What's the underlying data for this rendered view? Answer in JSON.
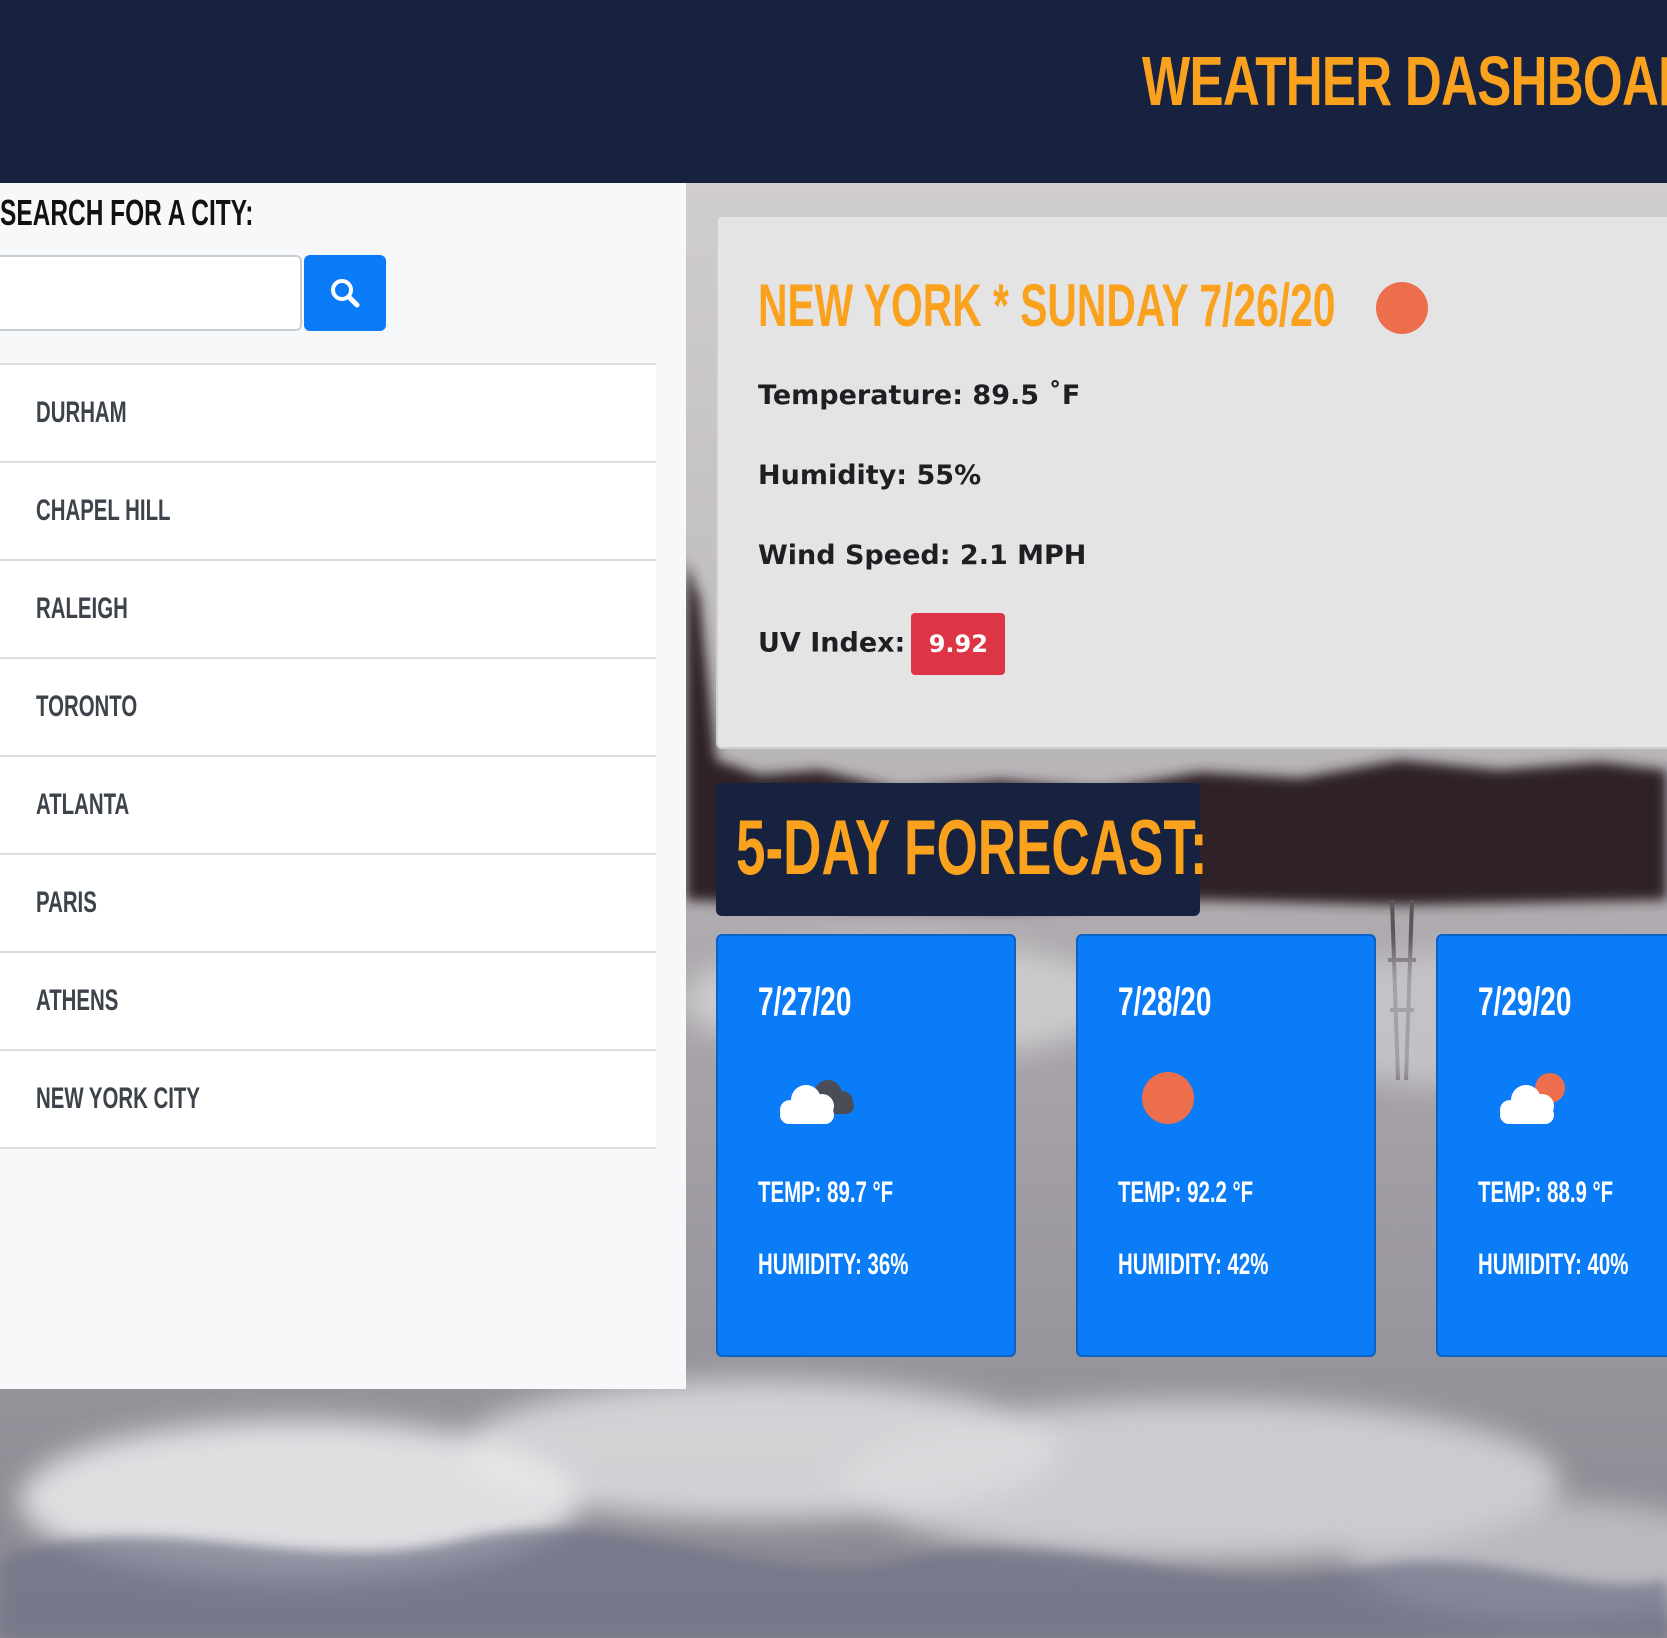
{
  "header": {
    "title": "WEATHER DASHBOARD"
  },
  "search": {
    "heading": "SEARCH FOR A CITY:",
    "input_value": "",
    "button_icon": "search-icon"
  },
  "cities": [
    {
      "label": "DURHAM"
    },
    {
      "label": "CHAPEL HILL"
    },
    {
      "label": "RALEIGH"
    },
    {
      "label": "TORONTO"
    },
    {
      "label": "ATLANTA"
    },
    {
      "label": "PARIS"
    },
    {
      "label": "ATHENS"
    },
    {
      "label": "NEW YORK CITY"
    }
  ],
  "current": {
    "title": "NEW YORK * SUNDAY 7/26/20",
    "icon": "sun-icon",
    "temperature": "Temperature: 89.5 ˚F",
    "humidity": "Humidity: 55%",
    "wind": "Wind Speed: 2.1 MPH",
    "uv_label": "UV Index:",
    "uv_value": "9.92",
    "uv_color": "#dd3545"
  },
  "forecast": {
    "heading": "5-DAY FORECAST:",
    "days": [
      {
        "date": "7/27/20",
        "icon": "broken-clouds-icon",
        "temp": "TEMP: 89.7 °F",
        "humidity": "HUMIDITY: 36%"
      },
      {
        "date": "7/28/20",
        "icon": "sun-icon",
        "temp": "TEMP: 92.2 °F",
        "humidity": "HUMIDITY: 42%"
      },
      {
        "date": "7/29/20",
        "icon": "partly-cloudy-icon",
        "temp": "TEMP: 88.9 °F",
        "humidity": "HUMIDITY: 40%"
      }
    ]
  },
  "colors": {
    "navy": "#162240",
    "accent_orange": "#faa21e",
    "primary_blue": "#0b7cf7",
    "sun": "#ec6e4c"
  }
}
